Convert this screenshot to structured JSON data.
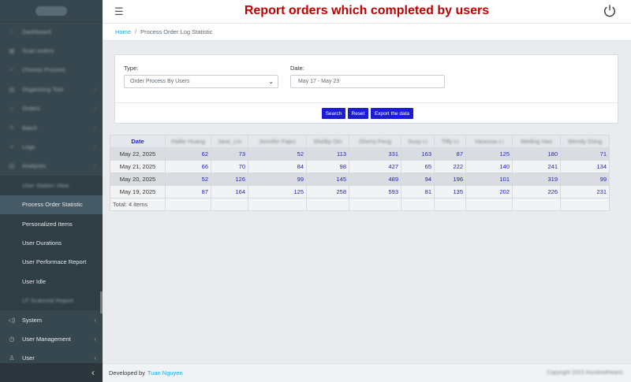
{
  "header": {
    "title": "Report orders which completed by users"
  },
  "breadcrumb": {
    "home": "Home",
    "separator": "/",
    "current": "Process Order Log Statistic"
  },
  "sidebar": {
    "items": [
      {
        "label": "Dashboard",
        "icon": "speedometer-icon",
        "chevron": false,
        "blurred": true
      },
      {
        "label": "Scan orders",
        "icon": "scan-icon",
        "chevron": false,
        "blurred": true
      },
      {
        "label": "Choose Process",
        "icon": "check-icon",
        "chevron": false,
        "blurred": true
      },
      {
        "label": "Organizing Tool",
        "icon": "grid-icon",
        "chevron": true,
        "blurred": true
      },
      {
        "label": "Orders",
        "icon": "cart-icon",
        "chevron": true,
        "blurred": true
      },
      {
        "label": "Batch",
        "icon": "edit-icon",
        "chevron": true,
        "blurred": true
      },
      {
        "label": "Logs",
        "icon": "list-icon",
        "chevron": true,
        "blurred": true
      },
      {
        "label": "Analyses",
        "icon": "chart-icon",
        "chevron": true,
        "blurred": true
      }
    ],
    "sub_items": [
      {
        "label": "User Station View",
        "active": false,
        "blurred": true
      },
      {
        "label": "Process Order Statistic",
        "active": true,
        "blurred": false
      },
      {
        "label": "Personalized Items",
        "active": false,
        "blurred": false
      },
      {
        "label": "User Durations",
        "active": false,
        "blurred": false
      },
      {
        "label": "User Performace Report",
        "active": false,
        "blurred": false
      },
      {
        "label": "User Idle",
        "active": false,
        "blurred": false
      },
      {
        "label": "LF Scanned Report",
        "active": false,
        "blurred": true
      }
    ],
    "bottom_items": [
      {
        "label": "System",
        "icon": "volume-icon",
        "chevron": true
      },
      {
        "label": "User Management",
        "icon": "clock-icon",
        "chevron": true
      },
      {
        "label": "User",
        "icon": "user-icon",
        "chevron": true
      }
    ],
    "collapse_icon": "‹"
  },
  "filters": {
    "type_label": "Type:",
    "type_value": "Order Process By Users",
    "date_label": "Date:",
    "date_value": "May 17 - May 23",
    "buttons": {
      "search": "Search",
      "reset": "Reset",
      "export": "Export the data"
    }
  },
  "table": {
    "date_header": "Date",
    "user_headers": [
      "Hallie Huang",
      "Jane_Lin",
      "Jennifer Fajes",
      "Shelby Din",
      "Sherry Feng",
      "Susy Li",
      "Tiffy Li",
      "Vanessa Li",
      "Weiling Hao",
      "Wendy Dong"
    ],
    "rows": [
      {
        "date": "May 22, 2025",
        "values": [
          62,
          73,
          52,
          113,
          331,
          163,
          87,
          125,
          180,
          71
        ]
      },
      {
        "date": "May 21, 2025",
        "values": [
          66,
          70,
          84,
          98,
          427,
          65,
          222,
          140,
          241,
          134
        ]
      },
      {
        "date": "May 20, 2025",
        "values": [
          52,
          126,
          99,
          145,
          489,
          94,
          196,
          101,
          319,
          99
        ]
      },
      {
        "date": "May 19, 2025",
        "values": [
          87,
          164,
          125,
          258,
          593,
          81,
          135,
          202,
          226,
          231
        ]
      }
    ],
    "total_label": "Total: 4 items"
  },
  "footer": {
    "prefix": "Developed by",
    "author": "Tuan Nguyen",
    "copyright": "Copyright 2023 HundredHearts"
  }
}
